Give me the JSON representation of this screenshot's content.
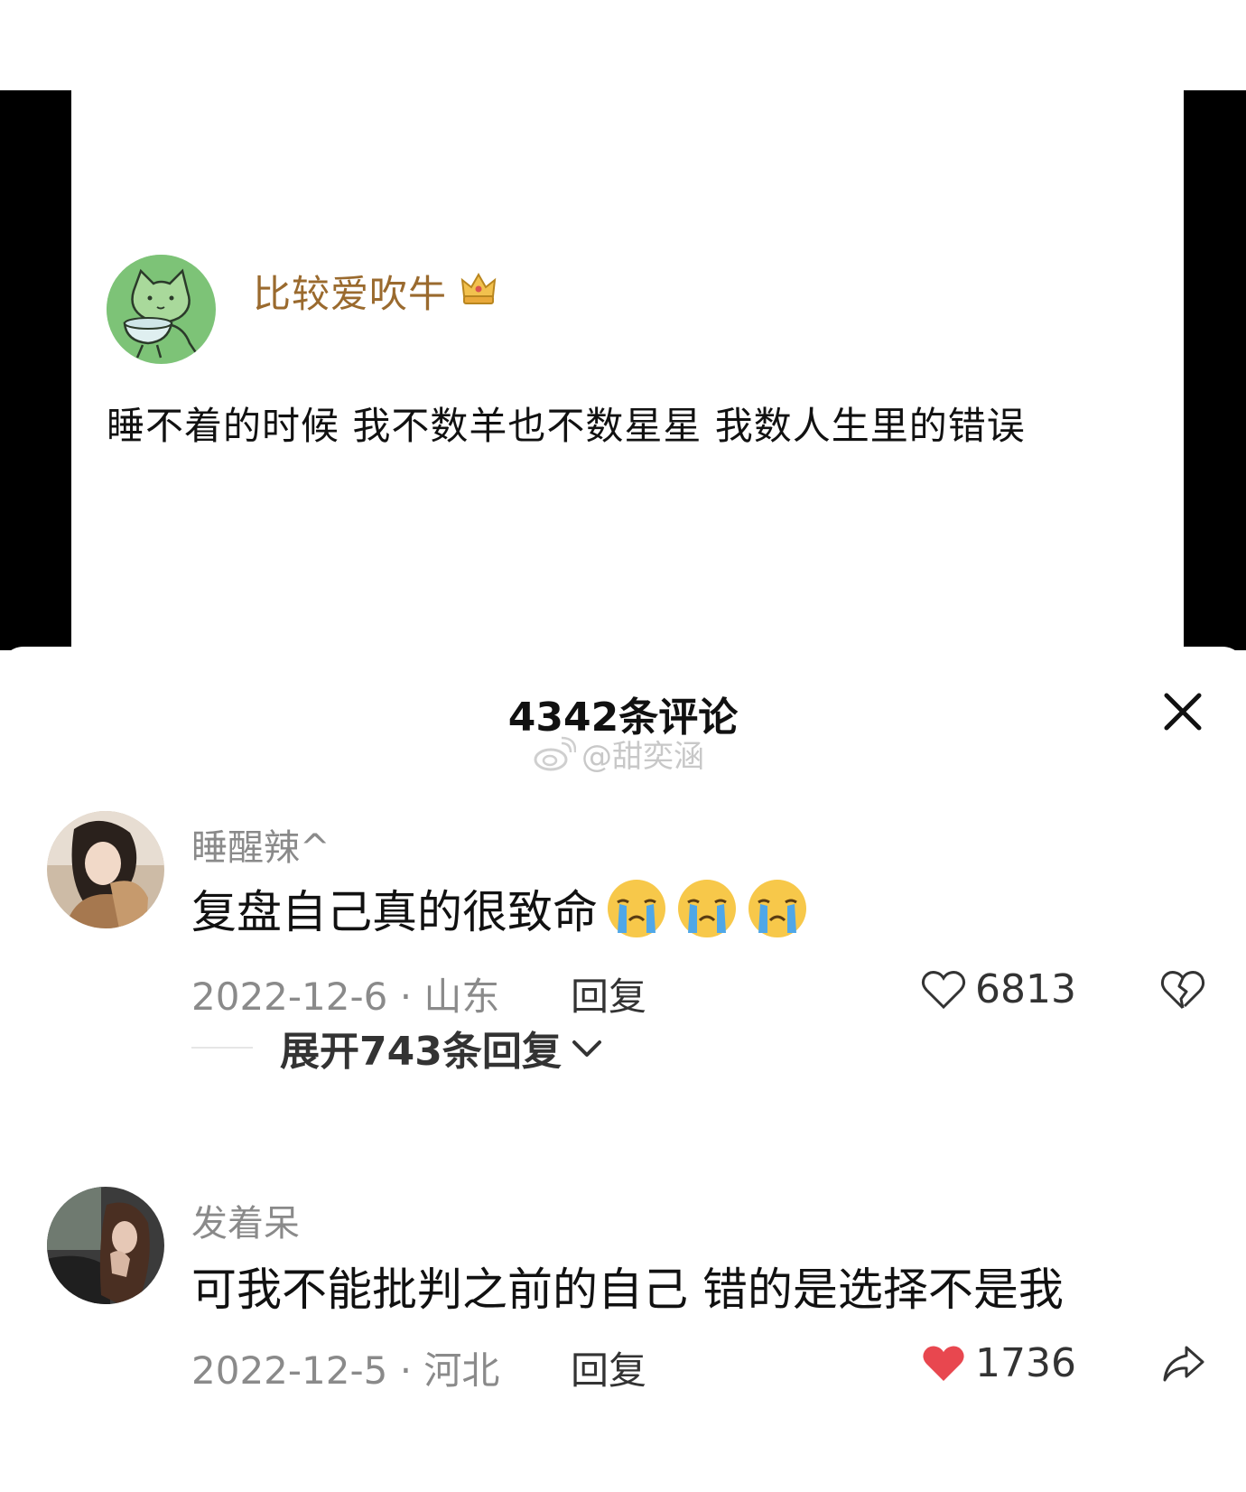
{
  "post": {
    "author_name": "比较爱吹牛",
    "text": "睡不着的时候 我不数羊也不数星星 我数人生里的错误"
  },
  "sheet": {
    "title": "4342条评论",
    "watermark": "@甜奕涵"
  },
  "comments": [
    {
      "name": "睡醒辣^",
      "text": "复盘自己真的很致命",
      "emojis": [
        "crying-face-icon",
        "crying-face-icon",
        "crying-face-icon"
      ],
      "date_location": "2022-12-6 · 山东",
      "reply_label": "回复",
      "likes": "6813",
      "liked": false
    },
    {
      "name": "发着呆",
      "text": "可我不能批判之前的自己 错的是选择不是我",
      "date_location": "2022-12-5 · 河北",
      "reply_label": "回复",
      "likes": "1736",
      "liked": true
    }
  ],
  "expand_replies": "展开743条回复",
  "colors": {
    "author_name": "#9a6a2e",
    "like_active": "#e8474f",
    "meta_gray": "#8a8a8a"
  }
}
